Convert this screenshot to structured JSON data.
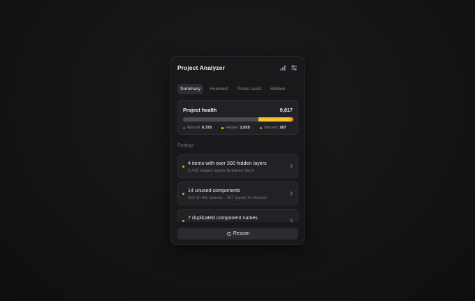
{
  "app": {
    "title": "Project Analyzer"
  },
  "header": {
    "icons": [
      "bar-chart-icon",
      "sliders-icon"
    ]
  },
  "tabs": [
    {
      "label": "Summary",
      "active": true
    },
    {
      "label": "Heaviest",
      "active": false
    },
    {
      "label": "Times used",
      "active": false
    },
    {
      "label": "Hidden",
      "active": false
    }
  ],
  "health": {
    "label": "Project health",
    "total": "9,817",
    "segments": [
      {
        "name": "Normal",
        "value": 6725,
        "color": "#4a4a50"
      },
      {
        "name": "Hidden",
        "value": 2825,
        "color": "#f2c230"
      },
      {
        "name": "Unused",
        "value": 267,
        "color": "#f08a24"
      }
    ],
    "legend": [
      {
        "label": "Normal",
        "value": "6,725",
        "color": "#6a6a70"
      },
      {
        "label": "Hidden",
        "value": "2,825",
        "color": "#f2c230"
      },
      {
        "label": "Unused",
        "value": "267",
        "color": "#f08a24"
      }
    ]
  },
  "findings": {
    "label": "Findings",
    "items": [
      {
        "title": "4 items with over 300 hidden layers",
        "subtitle": "2,410 hidden layers between them"
      },
      {
        "title": "14 unused components",
        "subtitle": "Not on the canvas · 267 layers to recover"
      },
      {
        "title": "7 duplicated component names",
        "subtitle": ""
      }
    ]
  },
  "actions": {
    "rescan_label": "Rescan"
  }
}
